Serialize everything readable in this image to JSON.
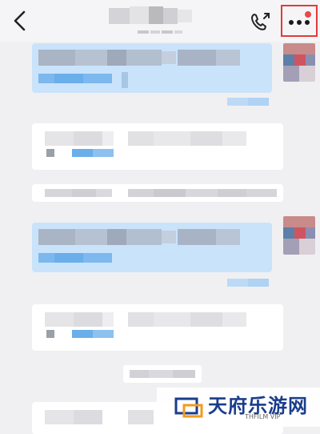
{
  "header": {
    "back_icon": "chevron-left-icon",
    "call_icon": "phone-call-icon",
    "more_icon": "more-dots-icon",
    "more_badge_color": "#e8484a",
    "highlight_color": "#e23a3a"
  },
  "watermark": {
    "brand": "天府乐游网",
    "site": "THFILM VIP"
  },
  "colors": {
    "outgoing_bubble": "#c9e3fb",
    "incoming_card": "#ffffff",
    "background": "#f0f0f2"
  }
}
